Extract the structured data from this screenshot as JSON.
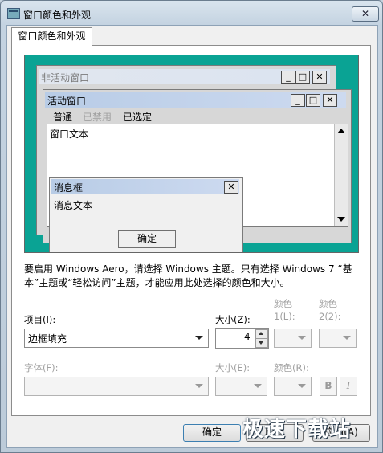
{
  "window": {
    "title": "窗口颜色和外观",
    "close_glyph": "✕"
  },
  "tab": {
    "label": "窗口颜色和外观"
  },
  "preview": {
    "inactive_title": "非活动窗口",
    "active_title": "活动窗口",
    "menu": [
      "普通",
      "已禁用",
      "已选定"
    ],
    "window_text": "窗口文本",
    "message_title": "消息框",
    "message_text": "消息文本",
    "ok_label": "确定",
    "minimize_glyph": "_",
    "maximize_glyph": "□",
    "close_glyph": "✕"
  },
  "note": "要启用 Windows Aero，请选择 Windows 主题。只有选择 Windows 7 “基本”主题或“轻松访问”主题，才能应用此处选择的颜色和大小。",
  "form": {
    "item_label": "项目(I):",
    "item_value": "边框填充",
    "size_label": "大小(Z):",
    "size_value": "4",
    "color1_label_a": "颜色",
    "color1_label_b": "1(L):",
    "color2_label_a": "颜色",
    "color2_label_b": "2(2):",
    "font_label": "字体(F):",
    "font_size_label": "大小(E):",
    "font_color_label": "颜色(R):",
    "bold_label": "B",
    "italic_label": "I"
  },
  "buttons": {
    "ok": "确定",
    "cancel": "取消",
    "apply": "应用(A)"
  },
  "watermark": "极速下载站"
}
